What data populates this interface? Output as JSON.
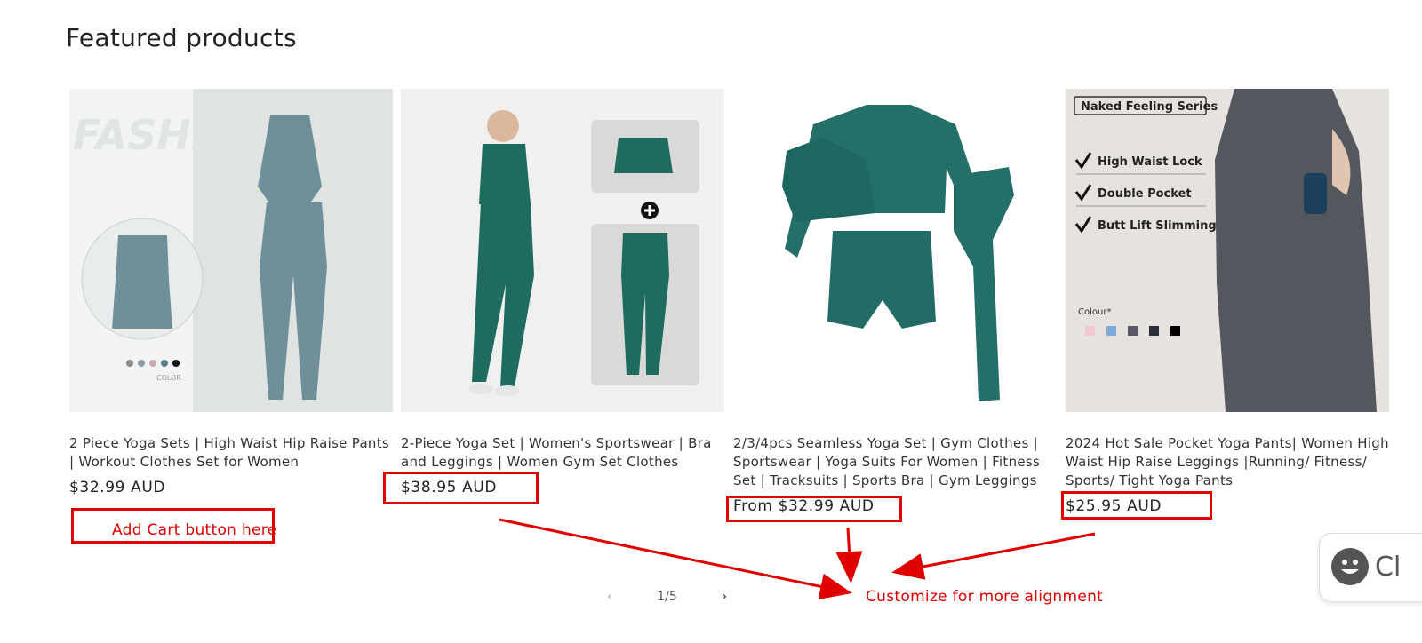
{
  "section": {
    "title": "Featured products"
  },
  "products": [
    {
      "title": "2 Piece Yoga Sets | High Waist Hip Raise Pants | Workout Clothes Set for Women",
      "price": "$32.99 AUD",
      "image_text": {
        "watermark": "FASHION",
        "color_label": "COLOR"
      }
    },
    {
      "title": "2-Piece Yoga Set | Women's Sportswear | Bra and Leggings | Women Gym Set Clothes",
      "price": "$38.95 AUD"
    },
    {
      "title": "2/3/4pcs Seamless Yoga Set | Gym Clothes | Sportswear | Yoga Suits For Women | Fitness Set | Tracksuits | Sports Bra | Gym Leggings",
      "price": "From $32.99 AUD"
    },
    {
      "title": "2024 Hot Sale Pocket Yoga Pants| Women High Waist Hip Raise Leggings |Running/ Fitness/ Sports/ Tight Yoga Pants",
      "price": "$25.95 AUD",
      "image_text": {
        "series": "Naked Feeling Series",
        "features": [
          "High Waist Lock",
          "Double Pocket",
          "Butt Lift Slimming"
        ],
        "colour_label": "Colour*"
      }
    }
  ],
  "pagination": {
    "prev_icon": "chevron-left-icon",
    "current": "1/5",
    "next_icon": "chevron-right-icon"
  },
  "annotations": {
    "add_cart": "Add Cart button here",
    "customize": "Customize for more alignment"
  },
  "chat": {
    "label": "Cl"
  },
  "colors": {
    "accent_red": "#e00000",
    "teal": "#1f6b5f",
    "sage": "#6f9098",
    "grey_pants": "#55575f"
  }
}
